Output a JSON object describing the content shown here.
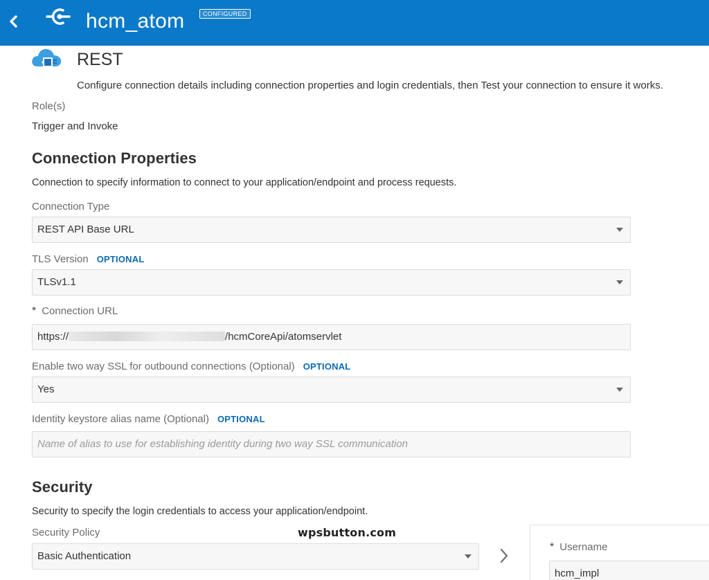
{
  "header": {
    "title": "hcm_atom",
    "badge": "CONFIGURED",
    "bg_color": "#0b79c9"
  },
  "adapter": {
    "name": "REST",
    "description": "Configure connection details including connection properties and login credentials, then Test your connection to ensure it works.",
    "icon": "cloud-rest-icon"
  },
  "roles": {
    "label": "Role(s)",
    "value": "Trigger and Invoke"
  },
  "connection_properties": {
    "heading": "Connection Properties",
    "description": "Connection to specify information to connect to your application/endpoint and process requests.",
    "connection_type": {
      "label": "Connection Type",
      "value": "REST API Base URL"
    },
    "tls_version": {
      "label": "TLS Version",
      "optional": "OPTIONAL",
      "value": "TLSv1.1"
    },
    "connection_url": {
      "required": "*",
      "label": "Connection URL",
      "value_prefix": "https://",
      "value_suffix": "/hcmCoreApi/atomservlet"
    },
    "two_way_ssl": {
      "label": "Enable two way SSL for outbound connections (Optional)",
      "optional": "OPTIONAL",
      "value": "Yes"
    },
    "keystore_alias": {
      "label": "Identity keystore alias name (Optional)",
      "optional": "OPTIONAL",
      "placeholder": "Name of alias to use for establishing identity during two way SSL communication"
    }
  },
  "security": {
    "heading": "Security",
    "description": "Security to specify the login credentials to access your application/endpoint.",
    "policy": {
      "label": "Security Policy",
      "value": "Basic Authentication"
    },
    "username": {
      "required": "*",
      "label": "Username",
      "value": "hcm_impl"
    }
  },
  "watermark": "wpsbutton.com"
}
